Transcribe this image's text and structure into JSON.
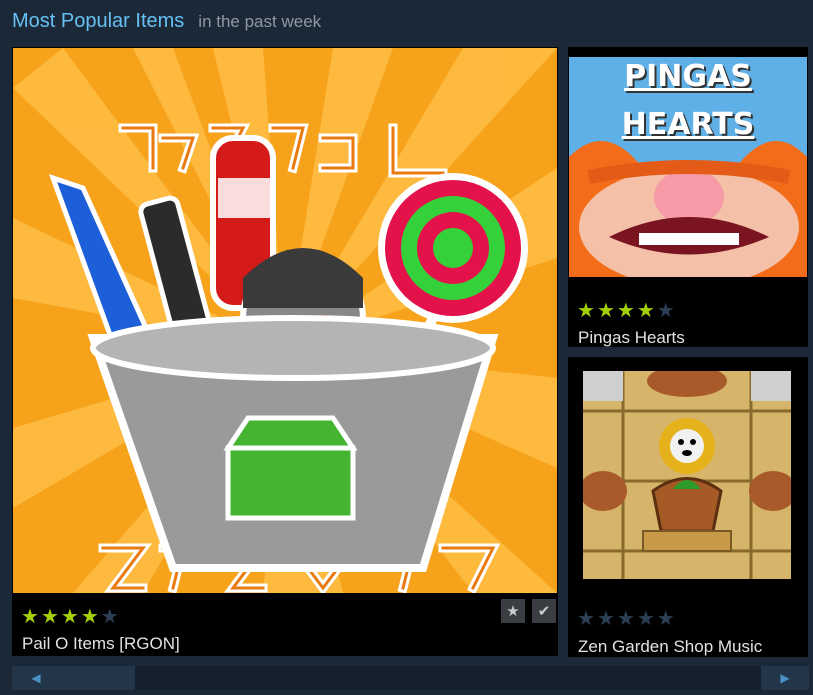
{
  "header": {
    "title": "Most Popular Items",
    "subtitle": "in the past week"
  },
  "items": [
    {
      "name": "Pail O Items [RGON]",
      "rating": 4,
      "max_rating": 5
    },
    {
      "name": "Pingas Hearts",
      "rating": 4,
      "max_rating": 5,
      "image_text": [
        "PINGAS",
        "HEARTS"
      ]
    },
    {
      "name": "Zen Garden Shop Music",
      "rating": 0,
      "max_rating": 5
    }
  ],
  "controls": {
    "favorite_icon": "star-icon",
    "subscribe_icon": "checkmark-icon",
    "scroll_left_icon": "arrow-left-icon",
    "scroll_right_icon": "arrow-right-icon"
  },
  "colors": {
    "accent": "#66c0f4",
    "background": "#1b2838",
    "star_on": "#a4d007",
    "star_off": "#2c3f54"
  }
}
